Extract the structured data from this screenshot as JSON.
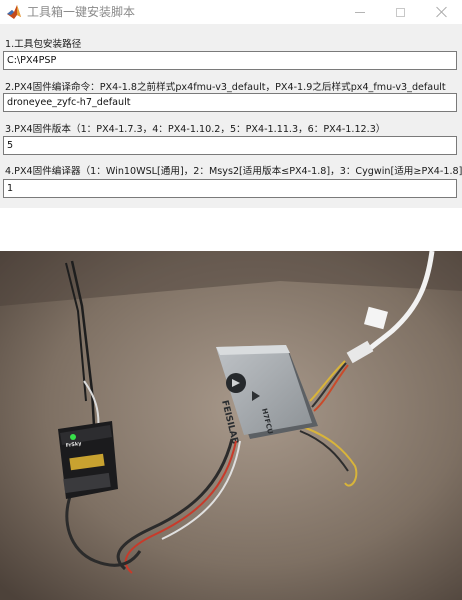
{
  "window": {
    "title": "工具箱一键安装脚本",
    "icon": "matlab-icon",
    "controls": [
      "minimize-icon",
      "maximize-icon",
      "close-icon"
    ]
  },
  "fields": [
    {
      "label": "1.工具包安装路径",
      "value": "C:\\PX4PSP"
    },
    {
      "label": "2.PX4固件编译命令：PX4-1.8之前样式px4fmu-v3_default，PX4-1.9之后样式px4_fmu-v3_default",
      "value": "droneyee_zyfc-h7_default"
    },
    {
      "label": "3.PX4固件版本（1：PX4-1.7.3，4：PX4-1.10.2，5：PX4-1.11.3，6：PX4-1.12.3）",
      "value": "5"
    },
    {
      "label": "4.PX4固件编译器（1：Win10WSL[通用]，2：Msys2[适用版本≤PX4-1.8]，3：Cygwin[适用≥PX4-1.8]",
      "value": "1"
    }
  ],
  "photo": {
    "flight_controller_brand": "FEISILAB",
    "flight_controller_model": "H7FCU",
    "receiver_brand": "FrSky"
  },
  "colors": {
    "window_bg": "#f0f0f0",
    "titlebar_bg": "#ffffff",
    "title_text": "#8a8a8a",
    "input_border": "#7a7a7a"
  }
}
